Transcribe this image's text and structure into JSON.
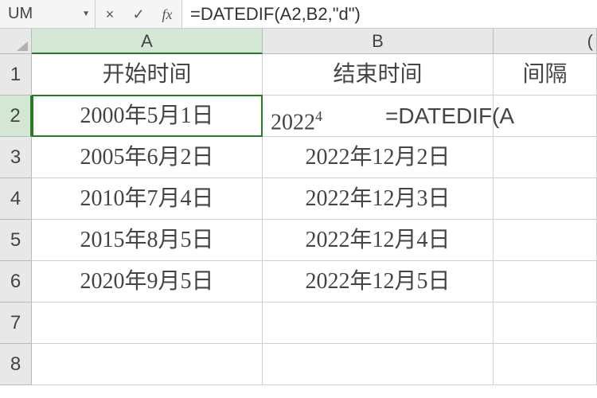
{
  "formula_bar": {
    "name_box": "UM",
    "cancel": "×",
    "confirm": "✓",
    "fx": "fx",
    "formula": "=DATEDIF(A2,B2,\"d\")"
  },
  "columns": [
    "A",
    "B",
    "C_partial"
  ],
  "column_c_glyph": "(",
  "active_cell": "A2",
  "headers": {
    "A": "开始时间",
    "B": "结束时间",
    "C": "间隔"
  },
  "rows": [
    {
      "n": 1,
      "A": "开始时间",
      "B": "结束时间",
      "C": "间隔"
    },
    {
      "n": 2,
      "A": "2000年5月1日",
      "B": "2022",
      "B_partial_marker": "4",
      "C_overflow": "=DATEDIF(A"
    },
    {
      "n": 3,
      "A": "2005年6月2日",
      "B": "2022年12月2日",
      "C": ""
    },
    {
      "n": 4,
      "A": "2010年7月4日",
      "B": "2022年12月3日",
      "C": ""
    },
    {
      "n": 5,
      "A": "2015年8月5日",
      "B": "2022年12月4日",
      "C": ""
    },
    {
      "n": 6,
      "A": "2020年9月5日",
      "B": "2022年12月5日",
      "C": ""
    },
    {
      "n": 7,
      "A": "",
      "B": "",
      "C": ""
    },
    {
      "n": 8,
      "A": "",
      "B": "",
      "C": ""
    }
  ]
}
